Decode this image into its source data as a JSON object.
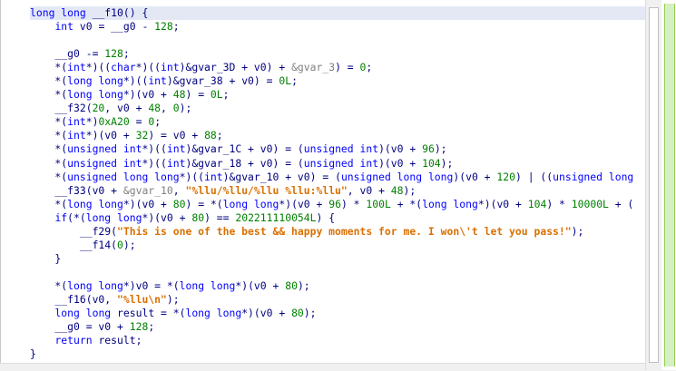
{
  "code_lines": [
    {
      "segs": [
        [
          "kw",
          "long long "
        ],
        [
          "var",
          "__f10() {"
        ]
      ]
    },
    {
      "segs": [
        [
          "var",
          "    "
        ],
        [
          "kw",
          "int"
        ],
        [
          "var",
          " v0 = __g0 - "
        ],
        [
          "num",
          "128"
        ],
        [
          "var",
          ";"
        ]
      ]
    },
    {
      "segs": [
        [
          "var",
          ""
        ]
      ]
    },
    {
      "segs": [
        [
          "var",
          "    __g0 -= "
        ],
        [
          "num",
          "128"
        ],
        [
          "var",
          ";"
        ]
      ]
    },
    {
      "segs": [
        [
          "var",
          "    *("
        ],
        [
          "kw",
          "int"
        ],
        [
          "var",
          "*)(("
        ],
        [
          "kw",
          "char"
        ],
        [
          "var",
          "*)(("
        ],
        [
          "kw",
          "int"
        ],
        [
          "var",
          ")&gvar_3D + v0) + "
        ],
        [
          "lbl",
          "&gvar_3"
        ],
        [
          "var",
          ") = "
        ],
        [
          "num",
          "0"
        ],
        [
          "var",
          ";"
        ]
      ]
    },
    {
      "segs": [
        [
          "var",
          "    *("
        ],
        [
          "kw",
          "long long"
        ],
        [
          "var",
          "*)(("
        ],
        [
          "kw",
          "int"
        ],
        [
          "var",
          ")&gvar_38 + v0) = "
        ],
        [
          "num",
          "0L"
        ],
        [
          "var",
          ";"
        ]
      ]
    },
    {
      "segs": [
        [
          "var",
          "    *("
        ],
        [
          "kw",
          "long long"
        ],
        [
          "var",
          "*)(v0 + "
        ],
        [
          "num",
          "48"
        ],
        [
          "var",
          ") = "
        ],
        [
          "num",
          "0L"
        ],
        [
          "var",
          ";"
        ]
      ]
    },
    {
      "segs": [
        [
          "var",
          "    __f32("
        ],
        [
          "num",
          "20"
        ],
        [
          "var",
          ", v0 + "
        ],
        [
          "num",
          "48"
        ],
        [
          "var",
          ", "
        ],
        [
          "num",
          "0"
        ],
        [
          "var",
          ");"
        ]
      ]
    },
    {
      "segs": [
        [
          "var",
          "    *("
        ],
        [
          "kw",
          "int"
        ],
        [
          "var",
          "*)"
        ],
        [
          "num",
          "0xA20"
        ],
        [
          "var",
          " = "
        ],
        [
          "num",
          "0"
        ],
        [
          "var",
          ";"
        ]
      ]
    },
    {
      "segs": [
        [
          "var",
          "    *("
        ],
        [
          "kw",
          "int"
        ],
        [
          "var",
          "*)(v0 + "
        ],
        [
          "num",
          "32"
        ],
        [
          "var",
          ") = v0 + "
        ],
        [
          "num",
          "88"
        ],
        [
          "var",
          ";"
        ]
      ]
    },
    {
      "segs": [
        [
          "var",
          "    *("
        ],
        [
          "kw",
          "unsigned int"
        ],
        [
          "var",
          "*)(("
        ],
        [
          "kw",
          "int"
        ],
        [
          "var",
          ")&gvar_1C + v0) = ("
        ],
        [
          "kw",
          "unsigned int"
        ],
        [
          "var",
          ")(v0 + "
        ],
        [
          "num",
          "96"
        ],
        [
          "var",
          ");"
        ]
      ]
    },
    {
      "segs": [
        [
          "var",
          "    *("
        ],
        [
          "kw",
          "unsigned int"
        ],
        [
          "var",
          "*)(("
        ],
        [
          "kw",
          "int"
        ],
        [
          "var",
          ")&gvar_18 + v0) = ("
        ],
        [
          "kw",
          "unsigned int"
        ],
        [
          "var",
          ")(v0 + "
        ],
        [
          "num",
          "104"
        ],
        [
          "var",
          ");"
        ]
      ]
    },
    {
      "segs": [
        [
          "var",
          "    *("
        ],
        [
          "kw",
          "unsigned long long"
        ],
        [
          "var",
          "*)(("
        ],
        [
          "kw",
          "int"
        ],
        [
          "var",
          ")&gvar_10 + v0) = ("
        ],
        [
          "kw",
          "unsigned long long"
        ],
        [
          "var",
          ")(v0 + "
        ],
        [
          "num",
          "120"
        ],
        [
          "var",
          ") | (("
        ],
        [
          "kw",
          "unsigned long"
        ]
      ]
    },
    {
      "segs": [
        [
          "var",
          "    __f33(v0 + "
        ],
        [
          "lbl",
          "&gvar_10"
        ],
        [
          "var",
          ", "
        ],
        [
          "str",
          "\"%llu/%llu/%llu %llu:%llu\""
        ],
        [
          "var",
          ", v0 + "
        ],
        [
          "num",
          "48"
        ],
        [
          "var",
          ");"
        ]
      ]
    },
    {
      "segs": [
        [
          "var",
          "    *("
        ],
        [
          "kw",
          "long long"
        ],
        [
          "var",
          "*)(v0 + "
        ],
        [
          "num",
          "80"
        ],
        [
          "var",
          ") = *("
        ],
        [
          "kw",
          "long long"
        ],
        [
          "var",
          "*)(v0 + "
        ],
        [
          "num",
          "96"
        ],
        [
          "var",
          ") * "
        ],
        [
          "num",
          "100L"
        ],
        [
          "var",
          " + *("
        ],
        [
          "kw",
          "long long"
        ],
        [
          "var",
          "*)(v0 + "
        ],
        [
          "num",
          "104"
        ],
        [
          "var",
          ") * "
        ],
        [
          "num",
          "10000L"
        ],
        [
          "var",
          " + ("
        ]
      ]
    },
    {
      "segs": [
        [
          "var",
          "    "
        ],
        [
          "kw",
          "if"
        ],
        [
          "var",
          "(*("
        ],
        [
          "kw",
          "long long"
        ],
        [
          "var",
          "*)(v0 + "
        ],
        [
          "num",
          "80"
        ],
        [
          "var",
          ") == "
        ],
        [
          "num",
          "202211110054L"
        ],
        [
          "var",
          ") {"
        ]
      ]
    },
    {
      "segs": [
        [
          "var",
          "        __f29("
        ],
        [
          "str",
          "\"This is one of the best && happy moments for me. I won\\'t let you pass!\""
        ],
        [
          "var",
          ");"
        ]
      ]
    },
    {
      "segs": [
        [
          "var",
          "        __f14("
        ],
        [
          "num",
          "0"
        ],
        [
          "var",
          ");"
        ]
      ]
    },
    {
      "segs": [
        [
          "var",
          "    }"
        ]
      ]
    },
    {
      "segs": [
        [
          "var",
          ""
        ]
      ]
    },
    {
      "segs": [
        [
          "var",
          "    *("
        ],
        [
          "kw",
          "long long"
        ],
        [
          "var",
          "*)v0 = *("
        ],
        [
          "kw",
          "long long"
        ],
        [
          "var",
          "*)(v0 + "
        ],
        [
          "num",
          "80"
        ],
        [
          "var",
          ");"
        ]
      ]
    },
    {
      "segs": [
        [
          "var",
          "    __f16(v0, "
        ],
        [
          "str",
          "\"%llu\\n\""
        ],
        [
          "var",
          ");"
        ]
      ]
    },
    {
      "segs": [
        [
          "var",
          "    "
        ],
        [
          "kw",
          "long long"
        ],
        [
          "var",
          " result = *("
        ],
        [
          "kw",
          "long long"
        ],
        [
          "var",
          "*)(v0 + "
        ],
        [
          "num",
          "80"
        ],
        [
          "var",
          ");"
        ]
      ]
    },
    {
      "segs": [
        [
          "var",
          "    __g0 = v0 + "
        ],
        [
          "num",
          "128"
        ],
        [
          "var",
          ";"
        ]
      ]
    },
    {
      "segs": [
        [
          "var",
          "    "
        ],
        [
          "kw",
          "return"
        ],
        [
          "var",
          " result;"
        ]
      ]
    },
    {
      "segs": [
        [
          "var",
          "}"
        ]
      ]
    }
  ],
  "current_line_index": 0
}
